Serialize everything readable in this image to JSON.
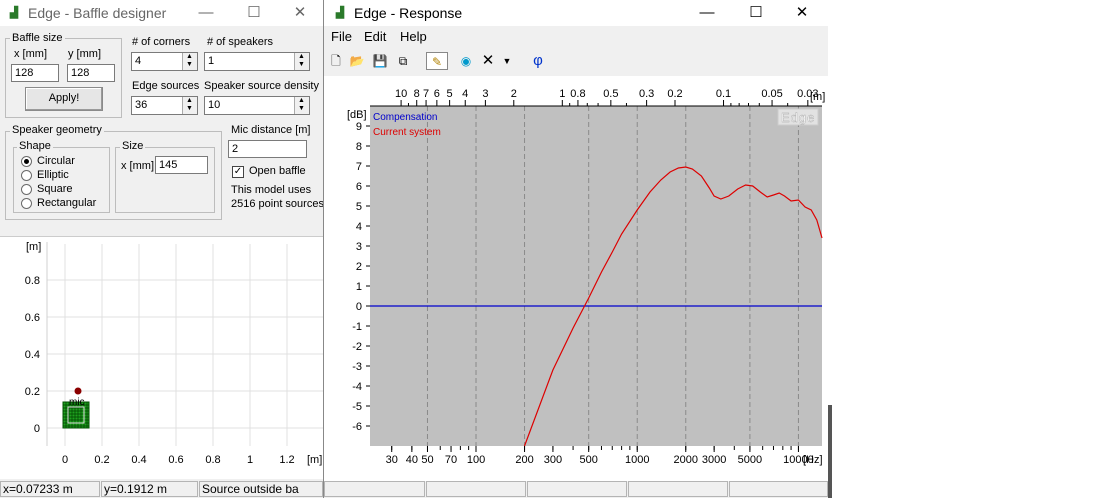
{
  "baffle": {
    "title": "Edge - Baffle designer",
    "baffle_size": {
      "legend": "Baffle size",
      "x_label": "x [mm]",
      "y_label": "y [mm]",
      "x_value": "128",
      "y_value": "128",
      "apply": "Apply!"
    },
    "corners": {
      "label": "# of corners",
      "value": "4"
    },
    "speakers": {
      "label": "# of speakers",
      "value": "1"
    },
    "edge_sources": {
      "label": "Edge sources",
      "value": "36"
    },
    "density": {
      "label": "Speaker source density",
      "value": "10"
    },
    "geometry": {
      "legend": "Speaker geometry",
      "shape_legend": "Shape",
      "shapes": [
        "Circular",
        "Elliptic",
        "Square",
        "Rectangular"
      ],
      "selected": 0
    },
    "size": {
      "legend": "Size",
      "x_label": "x [mm]",
      "x_value": "145"
    },
    "mic": {
      "label": "Mic distance [m]",
      "value": "2"
    },
    "open_baffle": {
      "label": "Open baffle",
      "checked": true
    },
    "model_info": {
      "line1": "This model uses",
      "line2": "2516 point sources"
    },
    "plot": {
      "y_unit": "[m]",
      "x_unit": "[m]",
      "y_ticks": [
        "0.8",
        "0.6",
        "0.4",
        "0.2",
        "0"
      ],
      "x_ticks": [
        "0",
        "0.2",
        "0.4",
        "0.6",
        "0.8",
        "1",
        "1.2"
      ],
      "mic_label": "mic"
    },
    "status": [
      "x=0.07233 m",
      "y=0.1912 m",
      "Source outside ba"
    ]
  },
  "response": {
    "title": "Edge - Response",
    "menu": [
      "File",
      "Edit",
      "Help"
    ],
    "phi": "φ",
    "watermark": "Edge",
    "top_ticks": [
      "10",
      "8",
      "7",
      "6",
      "5",
      "4",
      "3",
      "2",
      "1",
      "0.8",
      "0.5",
      "0.3",
      "0.2",
      "0.1",
      "0.05",
      "0.03"
    ],
    "top_unit": "[m]",
    "colors": {
      "plot_bg": "#c0c0c0",
      "compensation": "#0000cc",
      "current": "#dd0000"
    }
  },
  "chart_data": {
    "type": "line",
    "ylabel": "[dB]",
    "xlabel": "[Hz]",
    "x_scale": "log",
    "xlim": [
      22,
      14000
    ],
    "ylim": [
      -7,
      10
    ],
    "y_ticks": [
      9,
      8,
      7,
      6,
      5,
      4,
      3,
      2,
      1,
      0,
      -1,
      -2,
      -3,
      -4,
      -5,
      -6
    ],
    "x_ticks": [
      {
        "value": 30,
        "label": "30"
      },
      {
        "value": 40,
        "label": "40"
      },
      {
        "value": 50,
        "label": "50"
      },
      {
        "value": 70,
        "label": "70"
      },
      {
        "value": 100,
        "label": "100"
      },
      {
        "value": 200,
        "label": "200"
      },
      {
        "value": 300,
        "label": "300"
      },
      {
        "value": 500,
        "label": "500"
      },
      {
        "value": 1000,
        "label": "1000"
      },
      {
        "value": 2000,
        "label": "2000"
      },
      {
        "value": 3000,
        "label": "3000"
      },
      {
        "value": 5000,
        "label": "5000"
      },
      {
        "value": 10000,
        "label": "10000"
      }
    ],
    "grid": true,
    "legend": "top-left",
    "series": [
      {
        "name": "Compensation",
        "color": "#0000cc",
        "points": [
          [
            22,
            0
          ],
          [
            14000,
            0
          ]
        ]
      },
      {
        "name": "Current system",
        "color": "#dd0000",
        "points": [
          [
            200,
            -7
          ],
          [
            300,
            -3.2
          ],
          [
            400,
            -1.1
          ],
          [
            500,
            0.4
          ],
          [
            600,
            1.7
          ],
          [
            700,
            2.7
          ],
          [
            800,
            3.6
          ],
          [
            1000,
            4.8
          ],
          [
            1200,
            5.7
          ],
          [
            1400,
            6.3
          ],
          [
            1600,
            6.7
          ],
          [
            1800,
            6.9
          ],
          [
            2000,
            6.95
          ],
          [
            2200,
            6.85
          ],
          [
            2500,
            6.5
          ],
          [
            2800,
            5.9
          ],
          [
            3000,
            5.5
          ],
          [
            3300,
            5.35
          ],
          [
            3700,
            5.5
          ],
          [
            4200,
            5.85
          ],
          [
            4700,
            6.05
          ],
          [
            5200,
            6.0
          ],
          [
            5800,
            5.7
          ],
          [
            6400,
            5.45
          ],
          [
            7000,
            5.55
          ],
          [
            7600,
            5.65
          ],
          [
            8200,
            5.5
          ],
          [
            9000,
            5.25
          ],
          [
            10000,
            5.3
          ],
          [
            11000,
            4.95
          ],
          [
            12000,
            4.8
          ],
          [
            13000,
            4.3
          ],
          [
            14000,
            3.4
          ]
        ]
      }
    ]
  }
}
